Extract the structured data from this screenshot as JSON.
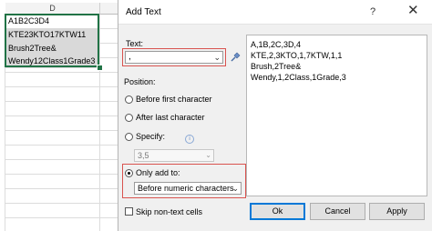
{
  "sheet": {
    "column_header": "D",
    "cells": [
      "A1B2C3D4",
      "KTE23KTO17KTW11",
      "Brush2Tree&",
      "Wendy12Class1Grade3"
    ]
  },
  "dialog": {
    "title": "Add Text",
    "help_label": "?",
    "close_label": "✕",
    "text_label": "Text:",
    "text_value": ",",
    "position_label": "Position:",
    "options": {
      "before_first": "Before first character",
      "after_last": "After last character",
      "specify": "Specify:",
      "only_add_to": "Only add to:"
    },
    "specify_value": "3,5",
    "only_add_to_value": "Before numeric characters",
    "skip_label": "Skip non-text cells",
    "preview_lines": [
      "A,1B,2C,3D,4",
      "KTE,2,3KTO,1,7KTW,1,1",
      "Brush,2Tree&",
      "Wendy,1,2Class,1Grade,3"
    ],
    "buttons": {
      "ok": "Ok",
      "cancel": "Cancel",
      "apply": "Apply"
    },
    "selected_position": "only_add_to"
  },
  "colors": {
    "accent": "#0078d7",
    "highlight": "#d9534f",
    "excel_green": "#217346"
  }
}
